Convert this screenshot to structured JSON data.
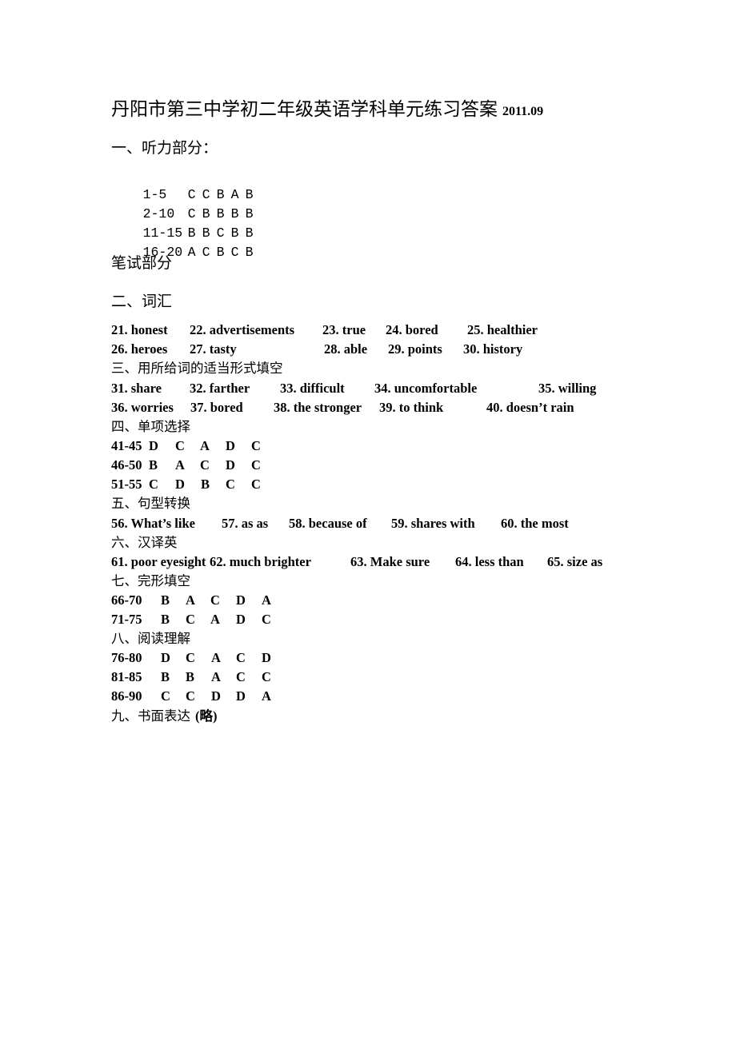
{
  "title": {
    "text": "丹阳市第三中学初二年级英语学科单元练习答案",
    "date": "2011.09"
  },
  "section1": {
    "heading": "一、听力部分：",
    "rows": [
      {
        "range": "1-5",
        "answers": [
          "C",
          "C",
          "B",
          "A",
          "B"
        ]
      },
      {
        "range": "2-10",
        "answers": [
          "C",
          "B",
          "B",
          "B",
          "B"
        ]
      },
      {
        "range": "11-15",
        "answers": [
          "B",
          "B",
          "C",
          "B",
          "B"
        ]
      },
      {
        "range": "16-20",
        "answers": [
          "A",
          "C",
          "B",
          "C",
          "B"
        ]
      }
    ]
  },
  "written_heading": "笔试部分",
  "section2": {
    "heading": "二、词汇",
    "rows": [
      [
        "21. honest",
        "22. advertisements",
        "23. true",
        "24. bored",
        "25. healthier"
      ],
      [
        "26. heroes",
        "27. tasty",
        "28. able",
        "29. points",
        "30. history"
      ]
    ]
  },
  "section3": {
    "heading": "三、用所给词的适当形式填空",
    "rows": [
      [
        "31. share",
        "32. farther",
        "33. difficult",
        "34. uncomfortable",
        "35. willing"
      ],
      [
        "36. worries",
        "37. bored",
        "38. the stronger",
        "39. to think",
        "40. doesn’t rain"
      ]
    ]
  },
  "section4": {
    "heading": "四、单项选择",
    "rows": [
      {
        "range": "41-45",
        "answers": [
          "D",
          "C",
          "A",
          "D",
          "C"
        ]
      },
      {
        "range": "46-50",
        "answers": [
          "B",
          "A",
          "C",
          "D",
          "C"
        ]
      },
      {
        "range": "51-55",
        "answers": [
          "C",
          "D",
          "B",
          "C",
          "C"
        ]
      }
    ]
  },
  "section5": {
    "heading": "五、句型转换",
    "row": [
      "56. What’s like",
      "57. as as",
      "58. because of",
      "59. shares with",
      "60. the most"
    ]
  },
  "section6": {
    "heading": "六、汉译英",
    "row": [
      "61. poor eyesight",
      "62. much brighter",
      "63. Make sure",
      "64. less than",
      "65. size as"
    ]
  },
  "section7": {
    "heading": "七、完形填空",
    "rows": [
      {
        "range": "66-70",
        "answers": [
          "B",
          "A",
          "C",
          "D",
          "A"
        ]
      },
      {
        "range": "71-75",
        "answers": [
          "B",
          "C",
          "A",
          "D",
          "C"
        ]
      }
    ]
  },
  "section8": {
    "heading": "八、阅读理解",
    "rows": [
      {
        "range": "76-80",
        "answers": [
          "D",
          "C",
          "A",
          "C",
          "D"
        ]
      },
      {
        "range": "81-85",
        "answers": [
          "B",
          "B",
          "A",
          "C",
          "C"
        ]
      },
      {
        "range": "86-90",
        "answers": [
          "C",
          "C",
          "D",
          "D",
          "A"
        ]
      }
    ]
  },
  "section9": {
    "heading": "九、书面表达",
    "note": "(略)"
  }
}
